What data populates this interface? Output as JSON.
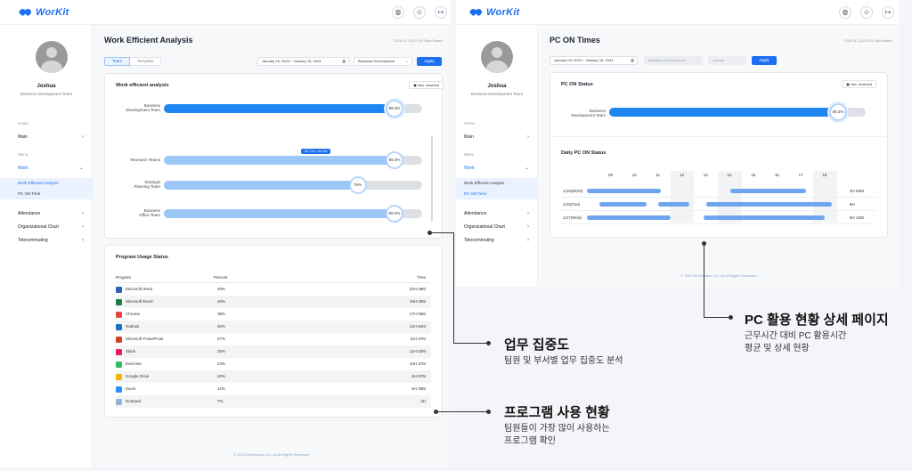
{
  "logo": "WorKit",
  "left_app": {
    "user": {
      "name": "Joshua",
      "team": "Business Development Team"
    },
    "nav": {
      "home_label": "Home",
      "main": "Main",
      "menu_label": "Menu",
      "work": "Work",
      "sub": [
        "Work Efficient Analysis",
        "PC ON Time"
      ],
      "attendance": "Attendance",
      "org_chart": "Organizational Chart",
      "telecommuting": "Telecommuting"
    },
    "page_title": "Work Efficient Analysis",
    "page_date": "2024-01-11(10:00) Data Based",
    "toggle": {
      "team": "Team",
      "template": "Template"
    },
    "date_from": "January 15, 2024",
    "date_sep": "~",
    "date_to": "January 15, 2024",
    "dept_select": "Business Development",
    "apply": "Apply",
    "efficiency_card": {
      "title": "Work efficient analysis",
      "download": "xlsx. downlod",
      "bars": [
        {
          "label": "Business\nDevelopment Team",
          "value": 89.3,
          "value_label": "89.3%",
          "color": "#1d86f0"
        },
        {
          "label": "Research Teams",
          "value": 89.3,
          "value_label": "89.3%",
          "color": "#9cc6f5"
        },
        {
          "label": "Strategic\nPlanning Team",
          "value": 75,
          "value_label": "75%",
          "color": "#9cc6f5"
        },
        {
          "label": "Business\nOffice Team",
          "value": 89.3,
          "value_label": "89.3%",
          "color": "#9cc6f5"
        }
      ],
      "tooltip": "30.7% / 40.3H"
    },
    "usage_card": {
      "title": "Program Usage Status",
      "headers": {
        "program": "Program",
        "percent": "Percent",
        "time": "Time"
      },
      "rows": [
        {
          "program": "Microsoft Word",
          "percent": "45%",
          "time": "24H 48M",
          "icon": "word-icon",
          "color": "#2b5fb8"
        },
        {
          "program": "Microsoft Excel",
          "percent": "40%",
          "time": "18H 25M",
          "icon": "excel-icon",
          "color": "#1f7a45"
        },
        {
          "program": "Chrome",
          "percent": "38%",
          "time": "17H 56M",
          "icon": "chrome-icon",
          "color": "#e8453c"
        },
        {
          "program": "Outlook",
          "percent": "30%",
          "time": "12H 52M",
          "icon": "outlook-icon",
          "color": "#1672c4"
        },
        {
          "program": "Microsoft PowerPoint",
          "percent": "27%",
          "time": "11H 37M",
          "icon": "powerpoint-icon",
          "color": "#d04423"
        },
        {
          "program": "Slack",
          "percent": "25%",
          "time": "11H 02M",
          "icon": "slack-icon",
          "color": "#e01e5a"
        },
        {
          "program": "Evernote",
          "percent": "23%",
          "time": "10H 37M",
          "icon": "evernote-icon",
          "color": "#2dbe60"
        },
        {
          "program": "Google Drive",
          "percent": "20%",
          "time": "8H 57M",
          "icon": "google-drive-icon",
          "color": "#f4b400"
        },
        {
          "program": "Zoom",
          "percent": "12%",
          "time": "5H 48M",
          "icon": "zoom-icon",
          "color": "#2d8cff"
        },
        {
          "program": "Notepad",
          "percent": "7%",
          "time": "3H",
          "icon": "notepad-icon",
          "color": "#8fb4d8"
        }
      ]
    },
    "footer": "© 2023 WorkSpace Co.,Ltd All Rights Reserved"
  },
  "right_app": {
    "user": {
      "name": "Joshua",
      "team": "Business Development Team"
    },
    "nav": {
      "home_label": "Home",
      "main": "Main",
      "menu_label": "Menu",
      "work": "Work",
      "sub": [
        "Work Efficient Analysis",
        "PC ON Time"
      ],
      "attendance": "Attendance",
      "org_chart": "Organizational Chart",
      "telecommuting": "Telecommuting"
    },
    "page_title": "PC ON Times",
    "page_date": "2024-01-11(10:00) Data Based",
    "date_from": "January 09, 2024",
    "date_sep": "~",
    "date_to": "January 18, 2024",
    "dept_select": "Business Development",
    "member_select": "Joshua",
    "apply": "Apply",
    "status_card": {
      "title": "PC ON Status",
      "download": "xlsx. downlod",
      "bar_label": "Business\nDevelopment Team",
      "value": 89.3,
      "value_label": "89.3%"
    },
    "daily_card": {
      "title": "Daily PC ON Status",
      "hours": [
        "09",
        "10",
        "11",
        "12",
        "13",
        "14",
        "15",
        "16",
        "17",
        "18"
      ],
      "days": [
        {
          "label": "1/15(MON)",
          "total": "3H 50M",
          "segments": [
            [
              8.0,
              11.1
            ],
            [
              14.0,
              17.2
            ]
          ]
        },
        {
          "label": "1/16(Tue)",
          "total": "8H",
          "segments": [
            [
              8.5,
              10.5
            ],
            [
              11.0,
              12.3
            ],
            [
              13.0,
              18.3
            ]
          ]
        },
        {
          "label": "1/17(Wed)",
          "total": "8H 10M",
          "segments": [
            [
              8.0,
              11.5
            ],
            [
              12.9,
              18.0
            ]
          ]
        }
      ]
    },
    "footer": "© 2023 WorkSpace Co.,Ltd All Rights Reserved"
  },
  "annotations": {
    "focus": {
      "title": "업무 집중도",
      "desc": "팀원 및 부서별 업무 집중도 분석"
    },
    "programs": {
      "title": "프로그램 사용 현황",
      "desc": [
        "팀원들이 가장 많이 사용하는",
        "프로그램 확인"
      ]
    },
    "pc_detail": {
      "title": "PC 활용 현황 상세 페이지",
      "desc": [
        "근무시간 대비 PC 활용시간",
        "평균 및 상세 현황"
      ]
    }
  }
}
